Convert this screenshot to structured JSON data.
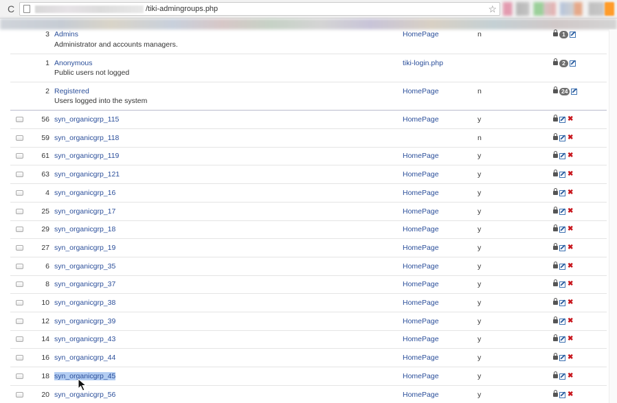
{
  "browser": {
    "url_path": "/tiki-admingroups.php",
    "reload_glyph": "C",
    "star_glyph": "☆",
    "icons": [
      "reload-icon",
      "page-icon",
      "bookmark-star-icon",
      "menu-icon"
    ]
  },
  "groups_table": {
    "icons": {
      "perm": "lock-icon",
      "edit": "edit-icon",
      "delete": "delete-icon",
      "delete_glyph": "✖"
    },
    "top_rows": [
      {
        "id": "3",
        "name": "Admins",
        "description": "Administrator and accounts managers.",
        "homepage": "HomePage",
        "flag": "n",
        "member_count": "1"
      },
      {
        "id": "1",
        "name": "Anonymous",
        "description": "Public users not logged",
        "homepage": "tiki-login.php",
        "flag": "",
        "member_count": "2"
      },
      {
        "id": "2",
        "name": "Registered",
        "description": "Users logged into the system",
        "homepage": "HomePage",
        "flag": "n",
        "member_count": "24"
      }
    ],
    "rows": [
      {
        "id": "56",
        "name": "syn_organicgrp_115",
        "homepage": "HomePage",
        "flag": "y"
      },
      {
        "id": "59",
        "name": "syn_organicgrp_118",
        "homepage": "",
        "flag": "n"
      },
      {
        "id": "61",
        "name": "syn_organicgrp_119",
        "homepage": "HomePage",
        "flag": "y"
      },
      {
        "id": "63",
        "name": "syn_organicgrp_121",
        "homepage": "HomePage",
        "flag": "y"
      },
      {
        "id": "4",
        "name": "syn_organicgrp_16",
        "homepage": "HomePage",
        "flag": "y"
      },
      {
        "id": "25",
        "name": "syn_organicgrp_17",
        "homepage": "HomePage",
        "flag": "y"
      },
      {
        "id": "29",
        "name": "syn_organicgrp_18",
        "homepage": "HomePage",
        "flag": "y"
      },
      {
        "id": "27",
        "name": "syn_organicgrp_19",
        "homepage": "HomePage",
        "flag": "y"
      },
      {
        "id": "6",
        "name": "syn_organicgrp_35",
        "homepage": "HomePage",
        "flag": "y"
      },
      {
        "id": "8",
        "name": "syn_organicgrp_37",
        "homepage": "HomePage",
        "flag": "y"
      },
      {
        "id": "10",
        "name": "syn_organicgrp_38",
        "homepage": "HomePage",
        "flag": "y"
      },
      {
        "id": "12",
        "name": "syn_organicgrp_39",
        "homepage": "HomePage",
        "flag": "y"
      },
      {
        "id": "14",
        "name": "syn_organicgrp_43",
        "homepage": "HomePage",
        "flag": "y"
      },
      {
        "id": "16",
        "name": "syn_organicgrp_44",
        "homepage": "HomePage",
        "flag": "y"
      },
      {
        "id": "18",
        "name": "syn_organicgrp_45",
        "homepage": "HomePage",
        "flag": "y",
        "selected": true
      },
      {
        "id": "20",
        "name": "syn_organicgrp_56",
        "homepage": "HomePage",
        "flag": "y"
      }
    ]
  }
}
